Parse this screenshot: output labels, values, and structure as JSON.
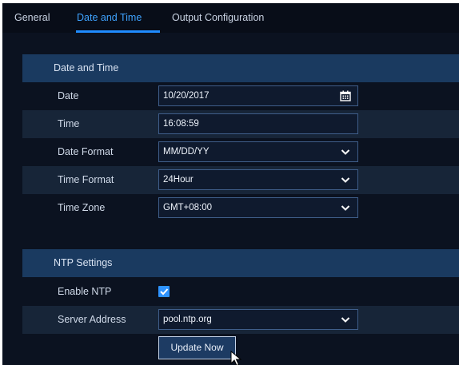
{
  "tabs": [
    {
      "label": "General",
      "active": false
    },
    {
      "label": "Date and Time",
      "active": true
    },
    {
      "label": "Output Configuration",
      "active": false
    }
  ],
  "date_time": {
    "title": "Date and Time",
    "date": {
      "label": "Date",
      "value": "10/20/2017",
      "icon": "calendar-icon"
    },
    "time": {
      "label": "Time",
      "value": "16:08:59"
    },
    "date_format": {
      "label": "Date Format",
      "value": "MM/DD/YY"
    },
    "time_format": {
      "label": "Time Format",
      "value": "24Hour"
    },
    "time_zone": {
      "label": "Time Zone",
      "value": "GMT+08:00"
    }
  },
  "ntp": {
    "title": "NTP Settings",
    "enable": {
      "label": "Enable NTP",
      "checked": true
    },
    "server": {
      "label": "Server Address",
      "value": "pool.ntp.org"
    },
    "update_label": "Update Now"
  },
  "colors": {
    "accent": "#1f8cff",
    "background": "#0b1220",
    "section_header": "#1a3a60"
  }
}
